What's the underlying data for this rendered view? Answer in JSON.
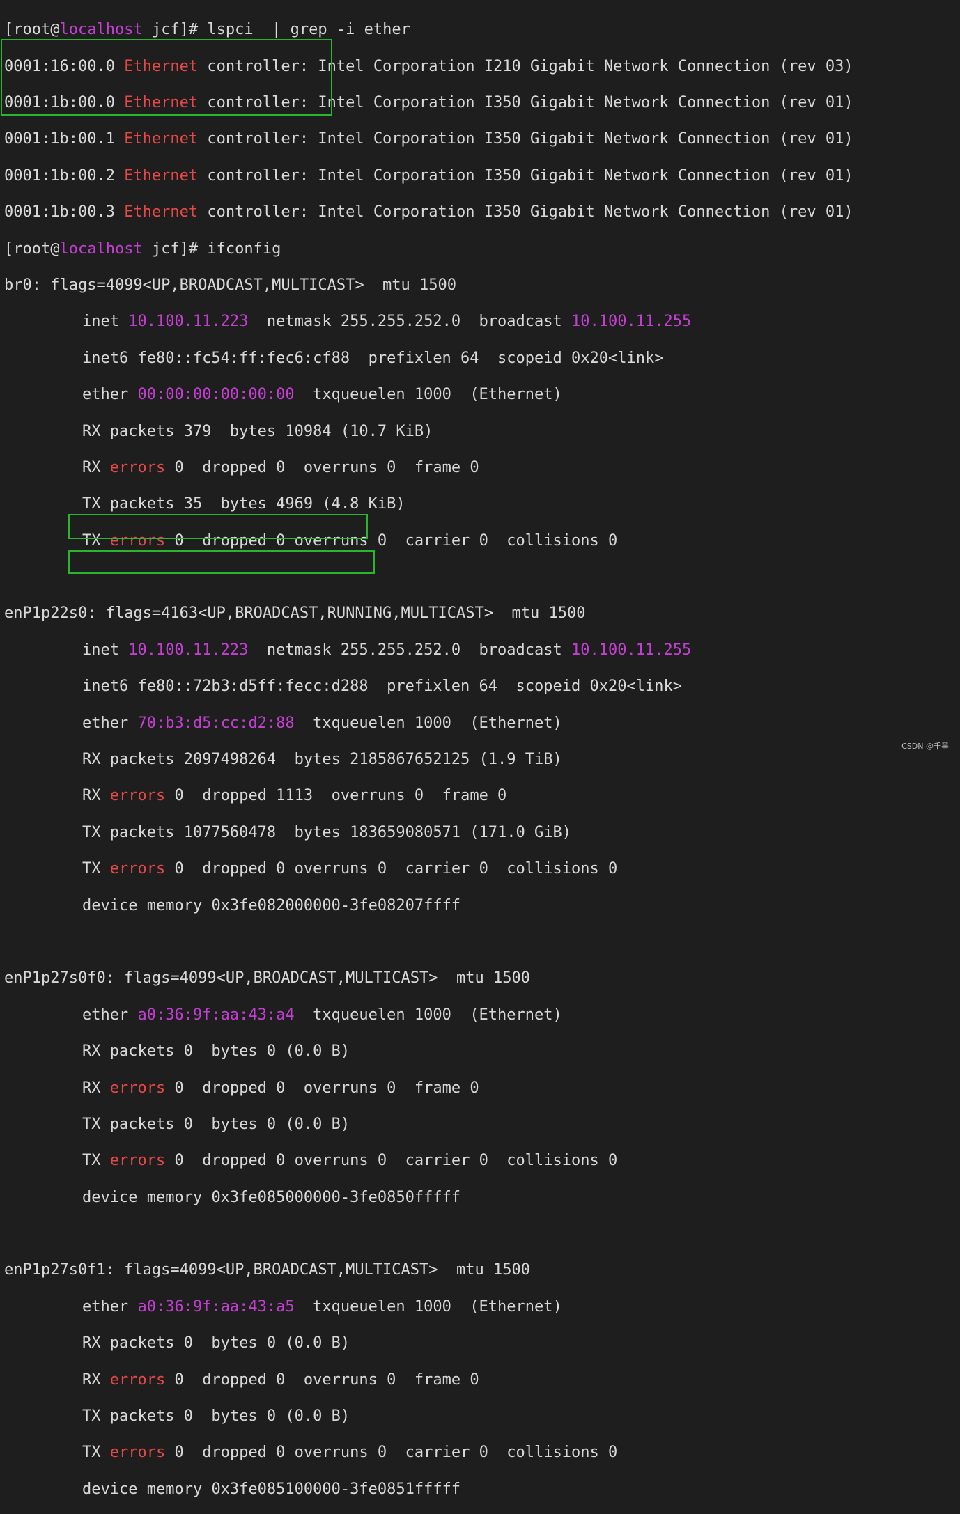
{
  "prompt": {
    "user": "[root@",
    "host": "localhost",
    "tail": " jcf]# "
  },
  "cmd1": "lspci  | grep -i ether",
  "lspci_rows": [
    {
      "slot": "0001:16:00.0 ",
      "kw": "Ethernet",
      "desc": " controller: Intel Corporation I210 Gigabit Network Connection (rev 03)"
    },
    {
      "slot": "0001:1b:00.0 ",
      "kw": "Ethernet",
      "desc": " controller: Intel Corporation I350 Gigabit Network Connection (rev 01)"
    },
    {
      "slot": "0001:1b:00.1 ",
      "kw": "Ethernet",
      "desc": " controller: Intel Corporation I350 Gigabit Network Connection (rev 01)"
    },
    {
      "slot": "0001:1b:00.2 ",
      "kw": "Ethernet",
      "desc": " controller: Intel Corporation I350 Gigabit Network Connection (rev 01)"
    },
    {
      "slot": "0001:1b:00.3 ",
      "kw": "Ethernet",
      "desc": " controller: Intel Corporation I350 Gigabit Network Connection (rev 01)"
    }
  ],
  "cmd2": "ifconfig",
  "w": {
    "inet": "inet ",
    "netmask": "  netmask ",
    "broadcast": "  broadcast ",
    "ether": "ether ",
    "txq": "  txqueuelen 1000  (Ethernet)",
    "rx": "RX ",
    "tx": "TX ",
    "errors": "errors",
    "dev": "device memory "
  },
  "ifaces": [
    {
      "header": "br0: flags=4099<UP,BROADCAST,MULTICAST>  mtu 1500",
      "inet": "10.100.11.223",
      "netmask": "255.255.252.0",
      "broadcast": "10.100.11.255",
      "inet6": "inet6 fe80::fc54:ff:fec6:cf88  prefixlen 64  scopeid 0x20<link>",
      "ether": "00:00:00:00:00:00",
      "rx_packets": "RX packets 379  bytes 10984 (10.7 KiB)",
      "rx_err": " 0  dropped 0  overruns 0  frame 0",
      "tx_packets": "TX packets 35  bytes 4969 (4.8 KiB)",
      "tx_err": " 0  dropped 0 overruns 0  carrier 0  collisions 0"
    },
    {
      "header": "enP1p22s0: flags=4163<UP,BROADCAST,RUNNING,MULTICAST>  mtu 1500",
      "inet": "10.100.11.223",
      "netmask": "255.255.252.0",
      "broadcast": "10.100.11.255",
      "inet6": "inet6 fe80::72b3:d5ff:fecc:d288  prefixlen 64  scopeid 0x20<link>",
      "ether": "70:b3:d5:cc:d2:88",
      "rx_packets": "RX packets 2097498264  bytes 2185867652125 (1.9 TiB)",
      "rx_err": " 0  dropped 1113  overruns 0  frame 0",
      "tx_packets": "TX packets 1077560478  bytes 183659080571 (171.0 GiB)",
      "tx_err": " 0  dropped 0 overruns 0  carrier 0  collisions 0",
      "devmem": "0x3fe082000000-3fe08207ffff"
    },
    {
      "header": "enP1p27s0f0: flags=4099<UP,BROADCAST,MULTICAST>  mtu 1500",
      "ether": "a0:36:9f:aa:43:a4",
      "rx_packets": "RX packets 0  bytes 0 (0.0 B)",
      "rx_err": " 0  dropped 0  overruns 0  frame 0",
      "tx_packets": "TX packets 0  bytes 0 (0.0 B)",
      "tx_err": " 0  dropped 0 overruns 0  carrier 0  collisions 0",
      "devmem": "0x3fe085000000-3fe0850fffff"
    },
    {
      "header": "enP1p27s0f1: flags=4099<UP,BROADCAST,MULTICAST>  mtu 1500",
      "ether": "a0:36:9f:aa:43:a5",
      "rx_packets": "RX packets 0  bytes 0 (0.0 B)",
      "rx_err": " 0  dropped 0  overruns 0  frame 0",
      "tx_packets": "TX packets 0  bytes 0 (0.0 B)",
      "tx_err": " 0  dropped 0 overruns 0  carrier 0  collisions 0",
      "devmem": "0x3fe085100000-3fe0851fffff"
    }
  ],
  "watermark": "CSDN @千墨",
  "colors": {
    "background": "#1e1e1e",
    "text": "#d8d8d8",
    "highlight": "#c33fd1",
    "error": "#e64848",
    "annotation_box": "#2bb52f"
  }
}
